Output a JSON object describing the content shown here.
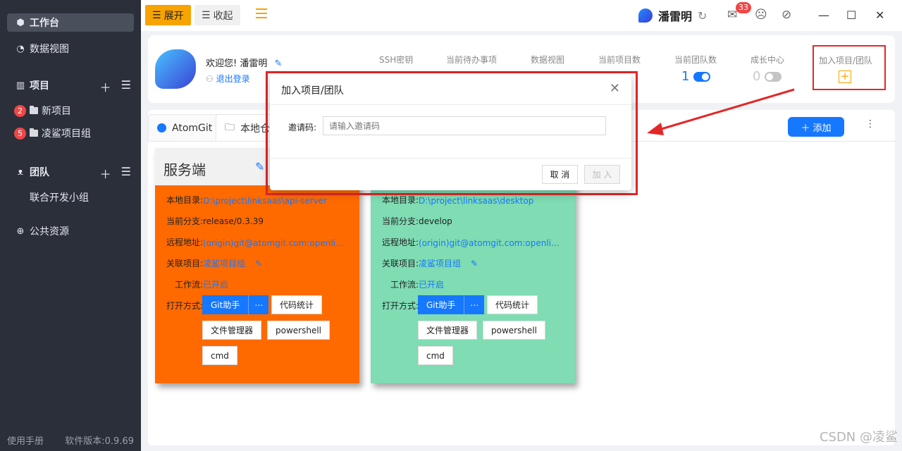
{
  "sidebar": {
    "workbench": "工作台",
    "data_view": "数据视图",
    "projects_header": "项目",
    "projects": [
      {
        "badge": "2",
        "label": "新项目"
      },
      {
        "badge": "5",
        "label": "凌鲨项目组"
      }
    ],
    "team_header": "团队",
    "teams": [
      {
        "label": "联合开发小组"
      }
    ],
    "public_resources": "公共资源",
    "manual": "使用手册",
    "version": "软件版本:0.9.69"
  },
  "topbar": {
    "expand": "展开",
    "collapse": "收起",
    "username": "潘雷明",
    "mail_count": "33"
  },
  "info": {
    "welcome": "欢迎您!  潘雷明",
    "logout": "退出登录",
    "stats": [
      {
        "label": "SSH密钥"
      },
      {
        "label": "当前待办事项"
      },
      {
        "label": "数据视图"
      },
      {
        "label": "当前项目数"
      },
      {
        "label": "当前团队数",
        "value": "1",
        "toggle": "on"
      },
      {
        "label": "成长中心",
        "value": "0",
        "toggle": "off"
      },
      {
        "label": "加入项目/团队"
      }
    ]
  },
  "tabs": [
    {
      "label": "AtomGit"
    },
    {
      "label": "本地仓"
    }
  ],
  "add_button": "添加",
  "repos": [
    {
      "name": "服务端",
      "color": "#ff6a00",
      "local_dir": "D:\\project\\linksaas\\api-server",
      "branch": "release/0.3.39",
      "remote": "(origin)git@atomgit.com:openlinksaas/api-server.git",
      "linked_project": "凌鲨项目组",
      "workflow": "已开启",
      "open_with": [
        "Git助手",
        "代码统计",
        "文件管理器",
        "powershell",
        "cmd"
      ]
    },
    {
      "name": "",
      "color": "#7fdcb3",
      "local_dir": "D:\\project\\linksaas\\desktop",
      "branch": "develop",
      "remote": "(origin)git@atomgit.com:openlinksaas/desktop.git",
      "linked_project": "凌鲨项目组",
      "workflow": "已开启",
      "open_with": [
        "Git助手",
        "代码统计",
        "文件管理器",
        "powershell",
        "cmd"
      ]
    }
  ],
  "labels": {
    "local_dir": "本地目录:",
    "branch": "当前分支:",
    "remote": "远程地址:",
    "linked_project": "关联项目:",
    "workflow": "工作流:",
    "open_with": "打开方式:"
  },
  "modal": {
    "title": "加入项目/团队",
    "field_label": "邀请码:",
    "placeholder": "请输入邀请码",
    "cancel": "取 消",
    "ok": "加 入"
  },
  "watermark": "CSDN @凌鲨",
  "colors": {
    "accent": "#1677ff",
    "orange": "#f7a300",
    "highlight_red": "#e32727"
  }
}
